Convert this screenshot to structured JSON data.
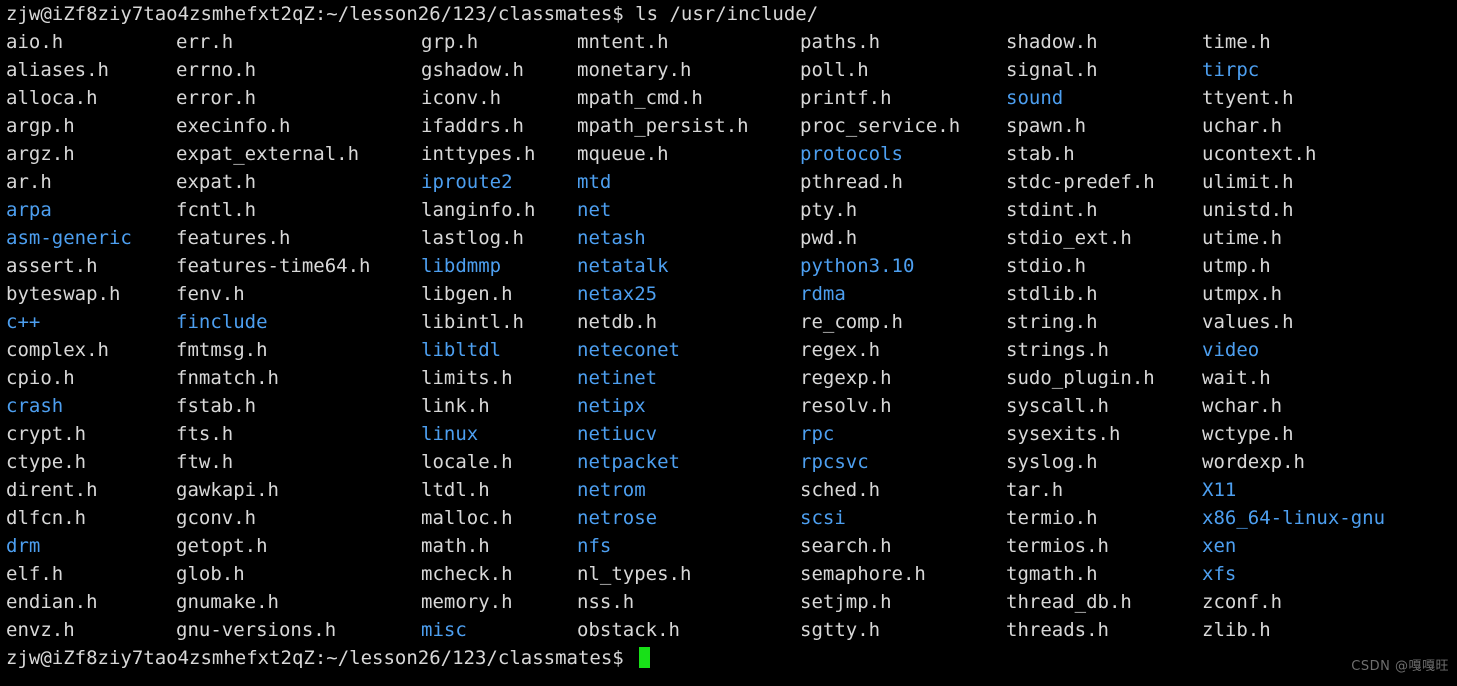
{
  "terminal": {
    "background_color": "#000000",
    "foreground_color": "#d8d8d8",
    "directory_color": "#4d9ff0",
    "cursor_color": "#18e018",
    "prompt_user_host": "zjw@iZf8ziy7tao4zsmhefxt2qZ",
    "prompt_separator": ":",
    "prompt_path": "~/lesson26/123/classmates",
    "prompt_symbol": "$",
    "command": " ls /usr/include/",
    "top_prompt_full": "zjw@iZf8ziy7tao4zsmhefxt2qZ:~/lesson26/123/classmates$ ls /usr/include/",
    "bottom_prompt_full": "zjw@iZf8ziy7tao4zsmhefxt2qZ:~/lesson26/123/classmates$ "
  },
  "column_offsets": [
    6,
    176,
    421,
    577,
    800,
    1006,
    1202
  ],
  "listing": {
    "rows": [
      [
        {
          "name": "aio.h",
          "type": "file"
        },
        {
          "name": "err.h",
          "type": "file"
        },
        {
          "name": "grp.h",
          "type": "file"
        },
        {
          "name": "mntent.h",
          "type": "file"
        },
        {
          "name": "paths.h",
          "type": "file"
        },
        {
          "name": "shadow.h",
          "type": "file"
        },
        {
          "name": "time.h",
          "type": "file"
        }
      ],
      [
        {
          "name": "aliases.h",
          "type": "file"
        },
        {
          "name": "errno.h",
          "type": "file"
        },
        {
          "name": "gshadow.h",
          "type": "file"
        },
        {
          "name": "monetary.h",
          "type": "file"
        },
        {
          "name": "poll.h",
          "type": "file"
        },
        {
          "name": "signal.h",
          "type": "file"
        },
        {
          "name": "tirpc",
          "type": "dir"
        }
      ],
      [
        {
          "name": "alloca.h",
          "type": "file"
        },
        {
          "name": "error.h",
          "type": "file"
        },
        {
          "name": "iconv.h",
          "type": "file"
        },
        {
          "name": "mpath_cmd.h",
          "type": "file"
        },
        {
          "name": "printf.h",
          "type": "file"
        },
        {
          "name": "sound",
          "type": "dir"
        },
        {
          "name": "ttyent.h",
          "type": "file"
        }
      ],
      [
        {
          "name": "argp.h",
          "type": "file"
        },
        {
          "name": "execinfo.h",
          "type": "file"
        },
        {
          "name": "ifaddrs.h",
          "type": "file"
        },
        {
          "name": "mpath_persist.h",
          "type": "file"
        },
        {
          "name": "proc_service.h",
          "type": "file"
        },
        {
          "name": "spawn.h",
          "type": "file"
        },
        {
          "name": "uchar.h",
          "type": "file"
        }
      ],
      [
        {
          "name": "argz.h",
          "type": "file"
        },
        {
          "name": "expat_external.h",
          "type": "file"
        },
        {
          "name": "inttypes.h",
          "type": "file"
        },
        {
          "name": "mqueue.h",
          "type": "file"
        },
        {
          "name": "protocols",
          "type": "dir"
        },
        {
          "name": "stab.h",
          "type": "file"
        },
        {
          "name": "ucontext.h",
          "type": "file"
        }
      ],
      [
        {
          "name": "ar.h",
          "type": "file"
        },
        {
          "name": "expat.h",
          "type": "file"
        },
        {
          "name": "iproute2",
          "type": "dir"
        },
        {
          "name": "mtd",
          "type": "dir"
        },
        {
          "name": "pthread.h",
          "type": "file"
        },
        {
          "name": "stdc-predef.h",
          "type": "file"
        },
        {
          "name": "ulimit.h",
          "type": "file"
        }
      ],
      [
        {
          "name": "arpa",
          "type": "dir"
        },
        {
          "name": "fcntl.h",
          "type": "file"
        },
        {
          "name": "langinfo.h",
          "type": "file"
        },
        {
          "name": "net",
          "type": "dir"
        },
        {
          "name": "pty.h",
          "type": "file"
        },
        {
          "name": "stdint.h",
          "type": "file"
        },
        {
          "name": "unistd.h",
          "type": "file"
        }
      ],
      [
        {
          "name": "asm-generic",
          "type": "dir"
        },
        {
          "name": "features.h",
          "type": "file"
        },
        {
          "name": "lastlog.h",
          "type": "file"
        },
        {
          "name": "netash",
          "type": "dir"
        },
        {
          "name": "pwd.h",
          "type": "file"
        },
        {
          "name": "stdio_ext.h",
          "type": "file"
        },
        {
          "name": "utime.h",
          "type": "file"
        }
      ],
      [
        {
          "name": "assert.h",
          "type": "file"
        },
        {
          "name": "features-time64.h",
          "type": "file"
        },
        {
          "name": "libdmmp",
          "type": "dir"
        },
        {
          "name": "netatalk",
          "type": "dir"
        },
        {
          "name": "python3.10",
          "type": "dir"
        },
        {
          "name": "stdio.h",
          "type": "file"
        },
        {
          "name": "utmp.h",
          "type": "file"
        }
      ],
      [
        {
          "name": "byteswap.h",
          "type": "file"
        },
        {
          "name": "fenv.h",
          "type": "file"
        },
        {
          "name": "libgen.h",
          "type": "file"
        },
        {
          "name": "netax25",
          "type": "dir"
        },
        {
          "name": "rdma",
          "type": "dir"
        },
        {
          "name": "stdlib.h",
          "type": "file"
        },
        {
          "name": "utmpx.h",
          "type": "file"
        }
      ],
      [
        {
          "name": "c++",
          "type": "dir"
        },
        {
          "name": "finclude",
          "type": "dir"
        },
        {
          "name": "libintl.h",
          "type": "file"
        },
        {
          "name": "netdb.h",
          "type": "file"
        },
        {
          "name": "re_comp.h",
          "type": "file"
        },
        {
          "name": "string.h",
          "type": "file"
        },
        {
          "name": "values.h",
          "type": "file"
        }
      ],
      [
        {
          "name": "complex.h",
          "type": "file"
        },
        {
          "name": "fmtmsg.h",
          "type": "file"
        },
        {
          "name": "libltdl",
          "type": "dir"
        },
        {
          "name": "neteconet",
          "type": "dir"
        },
        {
          "name": "regex.h",
          "type": "file"
        },
        {
          "name": "strings.h",
          "type": "file"
        },
        {
          "name": "video",
          "type": "dir"
        }
      ],
      [
        {
          "name": "cpio.h",
          "type": "file"
        },
        {
          "name": "fnmatch.h",
          "type": "file"
        },
        {
          "name": "limits.h",
          "type": "file"
        },
        {
          "name": "netinet",
          "type": "dir"
        },
        {
          "name": "regexp.h",
          "type": "file"
        },
        {
          "name": "sudo_plugin.h",
          "type": "file"
        },
        {
          "name": "wait.h",
          "type": "file"
        }
      ],
      [
        {
          "name": "crash",
          "type": "dir"
        },
        {
          "name": "fstab.h",
          "type": "file"
        },
        {
          "name": "link.h",
          "type": "file"
        },
        {
          "name": "netipx",
          "type": "dir"
        },
        {
          "name": "resolv.h",
          "type": "file"
        },
        {
          "name": "syscall.h",
          "type": "file"
        },
        {
          "name": "wchar.h",
          "type": "file"
        }
      ],
      [
        {
          "name": "crypt.h",
          "type": "file"
        },
        {
          "name": "fts.h",
          "type": "file"
        },
        {
          "name": "linux",
          "type": "dir"
        },
        {
          "name": "netiucv",
          "type": "dir"
        },
        {
          "name": "rpc",
          "type": "dir"
        },
        {
          "name": "sysexits.h",
          "type": "file"
        },
        {
          "name": "wctype.h",
          "type": "file"
        }
      ],
      [
        {
          "name": "ctype.h",
          "type": "file"
        },
        {
          "name": "ftw.h",
          "type": "file"
        },
        {
          "name": "locale.h",
          "type": "file"
        },
        {
          "name": "netpacket",
          "type": "dir"
        },
        {
          "name": "rpcsvc",
          "type": "dir"
        },
        {
          "name": "syslog.h",
          "type": "file"
        },
        {
          "name": "wordexp.h",
          "type": "file"
        }
      ],
      [
        {
          "name": "dirent.h",
          "type": "file"
        },
        {
          "name": "gawkapi.h",
          "type": "file"
        },
        {
          "name": "ltdl.h",
          "type": "file"
        },
        {
          "name": "netrom",
          "type": "dir"
        },
        {
          "name": "sched.h",
          "type": "file"
        },
        {
          "name": "tar.h",
          "type": "file"
        },
        {
          "name": "X11",
          "type": "dir"
        }
      ],
      [
        {
          "name": "dlfcn.h",
          "type": "file"
        },
        {
          "name": "gconv.h",
          "type": "file"
        },
        {
          "name": "malloc.h",
          "type": "file"
        },
        {
          "name": "netrose",
          "type": "dir"
        },
        {
          "name": "scsi",
          "type": "dir"
        },
        {
          "name": "termio.h",
          "type": "file"
        },
        {
          "name": "x86_64-linux-gnu",
          "type": "dir"
        }
      ],
      [
        {
          "name": "drm",
          "type": "dir"
        },
        {
          "name": "getopt.h",
          "type": "file"
        },
        {
          "name": "math.h",
          "type": "file"
        },
        {
          "name": "nfs",
          "type": "dir"
        },
        {
          "name": "search.h",
          "type": "file"
        },
        {
          "name": "termios.h",
          "type": "file"
        },
        {
          "name": "xen",
          "type": "dir"
        }
      ],
      [
        {
          "name": "elf.h",
          "type": "file"
        },
        {
          "name": "glob.h",
          "type": "file"
        },
        {
          "name": "mcheck.h",
          "type": "file"
        },
        {
          "name": "nl_types.h",
          "type": "file"
        },
        {
          "name": "semaphore.h",
          "type": "file"
        },
        {
          "name": "tgmath.h",
          "type": "file"
        },
        {
          "name": "xfs",
          "type": "dir"
        }
      ],
      [
        {
          "name": "endian.h",
          "type": "file"
        },
        {
          "name": "gnumake.h",
          "type": "file"
        },
        {
          "name": "memory.h",
          "type": "file"
        },
        {
          "name": "nss.h",
          "type": "file"
        },
        {
          "name": "setjmp.h",
          "type": "file"
        },
        {
          "name": "thread_db.h",
          "type": "file"
        },
        {
          "name": "zconf.h",
          "type": "file"
        }
      ],
      [
        {
          "name": "envz.h",
          "type": "file"
        },
        {
          "name": "gnu-versions.h",
          "type": "file"
        },
        {
          "name": "misc",
          "type": "dir"
        },
        {
          "name": "obstack.h",
          "type": "file"
        },
        {
          "name": "sgtty.h",
          "type": "file"
        },
        {
          "name": "threads.h",
          "type": "file"
        },
        {
          "name": "zlib.h",
          "type": "file"
        }
      ]
    ]
  },
  "watermark": {
    "text": "CSDN @嘎嘎旺"
  }
}
